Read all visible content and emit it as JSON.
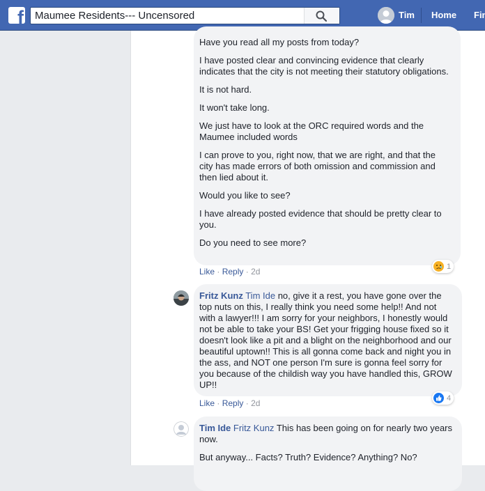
{
  "header": {
    "search_value": "Maumee Residents--- Uncensored",
    "user_name": "Tim",
    "home_label": "Home",
    "find_label": "Fin",
    "brand_letter": "f"
  },
  "comments": [
    {
      "paragraphs": [
        "Have you read all my posts from today?",
        "I have posted clear and convincing evidence that clearly indicates that the city is not meeting their statutory obligations.",
        "It is not hard.",
        "It won't take long.",
        "We just have to look at the ORC required words and the Maumee included words",
        "I can prove to you, right now, that we are right, and that the city has made errors of both omission and commission and then lied about it.",
        "Would you like to see?",
        "I have already posted evidence that should be pretty clear to you.",
        "Do you need to see more?"
      ],
      "like": "Like",
      "reply": "Reply",
      "time": "2d",
      "reaction_count": "1",
      "reaction_icon": "sad-face-icon"
    },
    {
      "author": "Fritz Kunz",
      "mention": "Tim Ide",
      "text": "no, give it a rest, you have gone over the top nuts on this, I really think you need some help!! And not with a lawyer!!! I am sorry for your neighbors, I honestly would not be able to take your BS! Get your frigging house fixed so it doesn't look like a pit and a blight on the neighborhood and our beautiful uptown!! This is all gonna come back and night you in the ass, and NOT one person I'm sure is gonna feel sorry for you because of the childish way you have handled this, GROW UP!!",
      "like": "Like",
      "reply": "Reply",
      "time": "2d",
      "reaction_count": "4",
      "reaction_icon": "thumbs-up-icon"
    },
    {
      "author": "Tim Ide",
      "mention": "Fritz Kunz",
      "text": "This has been going on for nearly two years now.",
      "paragraph2": "But anyway... Facts? Truth? Evidence? Anything? No?"
    }
  ],
  "colors": {
    "topbar": "#4267b2",
    "link": "#385898",
    "bubble": "#f2f3f5",
    "like_blue": "#1877f2",
    "sad_yellow": "#f7b125"
  }
}
